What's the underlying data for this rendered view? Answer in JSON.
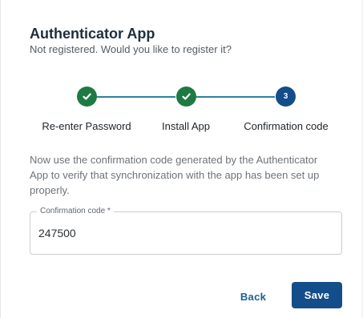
{
  "header": {
    "title": "Authenticator App",
    "subtitle": "Not registered. Would you like to register it?"
  },
  "stepper": {
    "steps": [
      {
        "label": "Re-enter Password",
        "status": "completed",
        "icon": "check-icon"
      },
      {
        "label": "Install App",
        "status": "completed",
        "icon": "check-icon"
      },
      {
        "label": "Confirmation code",
        "status": "active",
        "number": "3"
      }
    ],
    "completed_color": "#1e7a43",
    "active_color": "#134d8a",
    "line_color": "#2f7f9b"
  },
  "description": "Now use the confirmation code generated by the Authenticator App to verify that synchronization with the app has been set up properly.",
  "confirmation_field": {
    "label": "Confirmation code *",
    "value": "247500"
  },
  "actions": {
    "back_label": "Back",
    "save_label": "Save"
  },
  "colors": {
    "primary": "#134d8a",
    "title": "#1f2e3d"
  }
}
